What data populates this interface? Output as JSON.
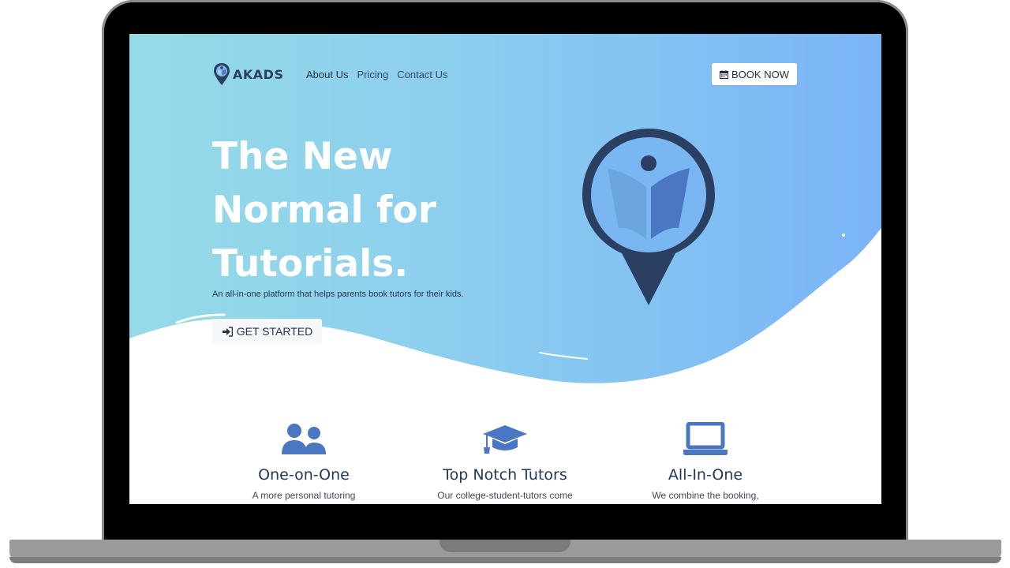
{
  "brand": {
    "name": "AKADS"
  },
  "nav": {
    "links": [
      {
        "label": "About Us",
        "active": true
      },
      {
        "label": "Pricing",
        "active": false
      },
      {
        "label": "Contact Us",
        "active": false
      }
    ],
    "book_label": "BOOK NOW",
    "book_icon": "calendar-icon"
  },
  "hero": {
    "headline_line1": "The New",
    "headline_line2": "Normal for",
    "headline_line3": "Tutorials.",
    "tagline": "An all-in-one platform that helps parents book tutors for their kids.",
    "cta_label": "GET STARTED",
    "cta_icon": "sign-in-icon",
    "illustration": "location-pin-book-icon"
  },
  "features": [
    {
      "icon": "users-icon",
      "title": "One-on-One",
      "desc": "A more personal tutoring"
    },
    {
      "icon": "graduation-cap-icon",
      "title": "Top Notch Tutors",
      "desc": "Our college-student-tutors come"
    },
    {
      "icon": "laptop-icon",
      "title": "All-In-One",
      "desc": "We combine the booking,"
    }
  ],
  "colors": {
    "gradient_start": "#95dbe7",
    "gradient_end": "#7ab4f7",
    "navy": "#2b3f63",
    "accent_blue": "#4a76c2"
  }
}
